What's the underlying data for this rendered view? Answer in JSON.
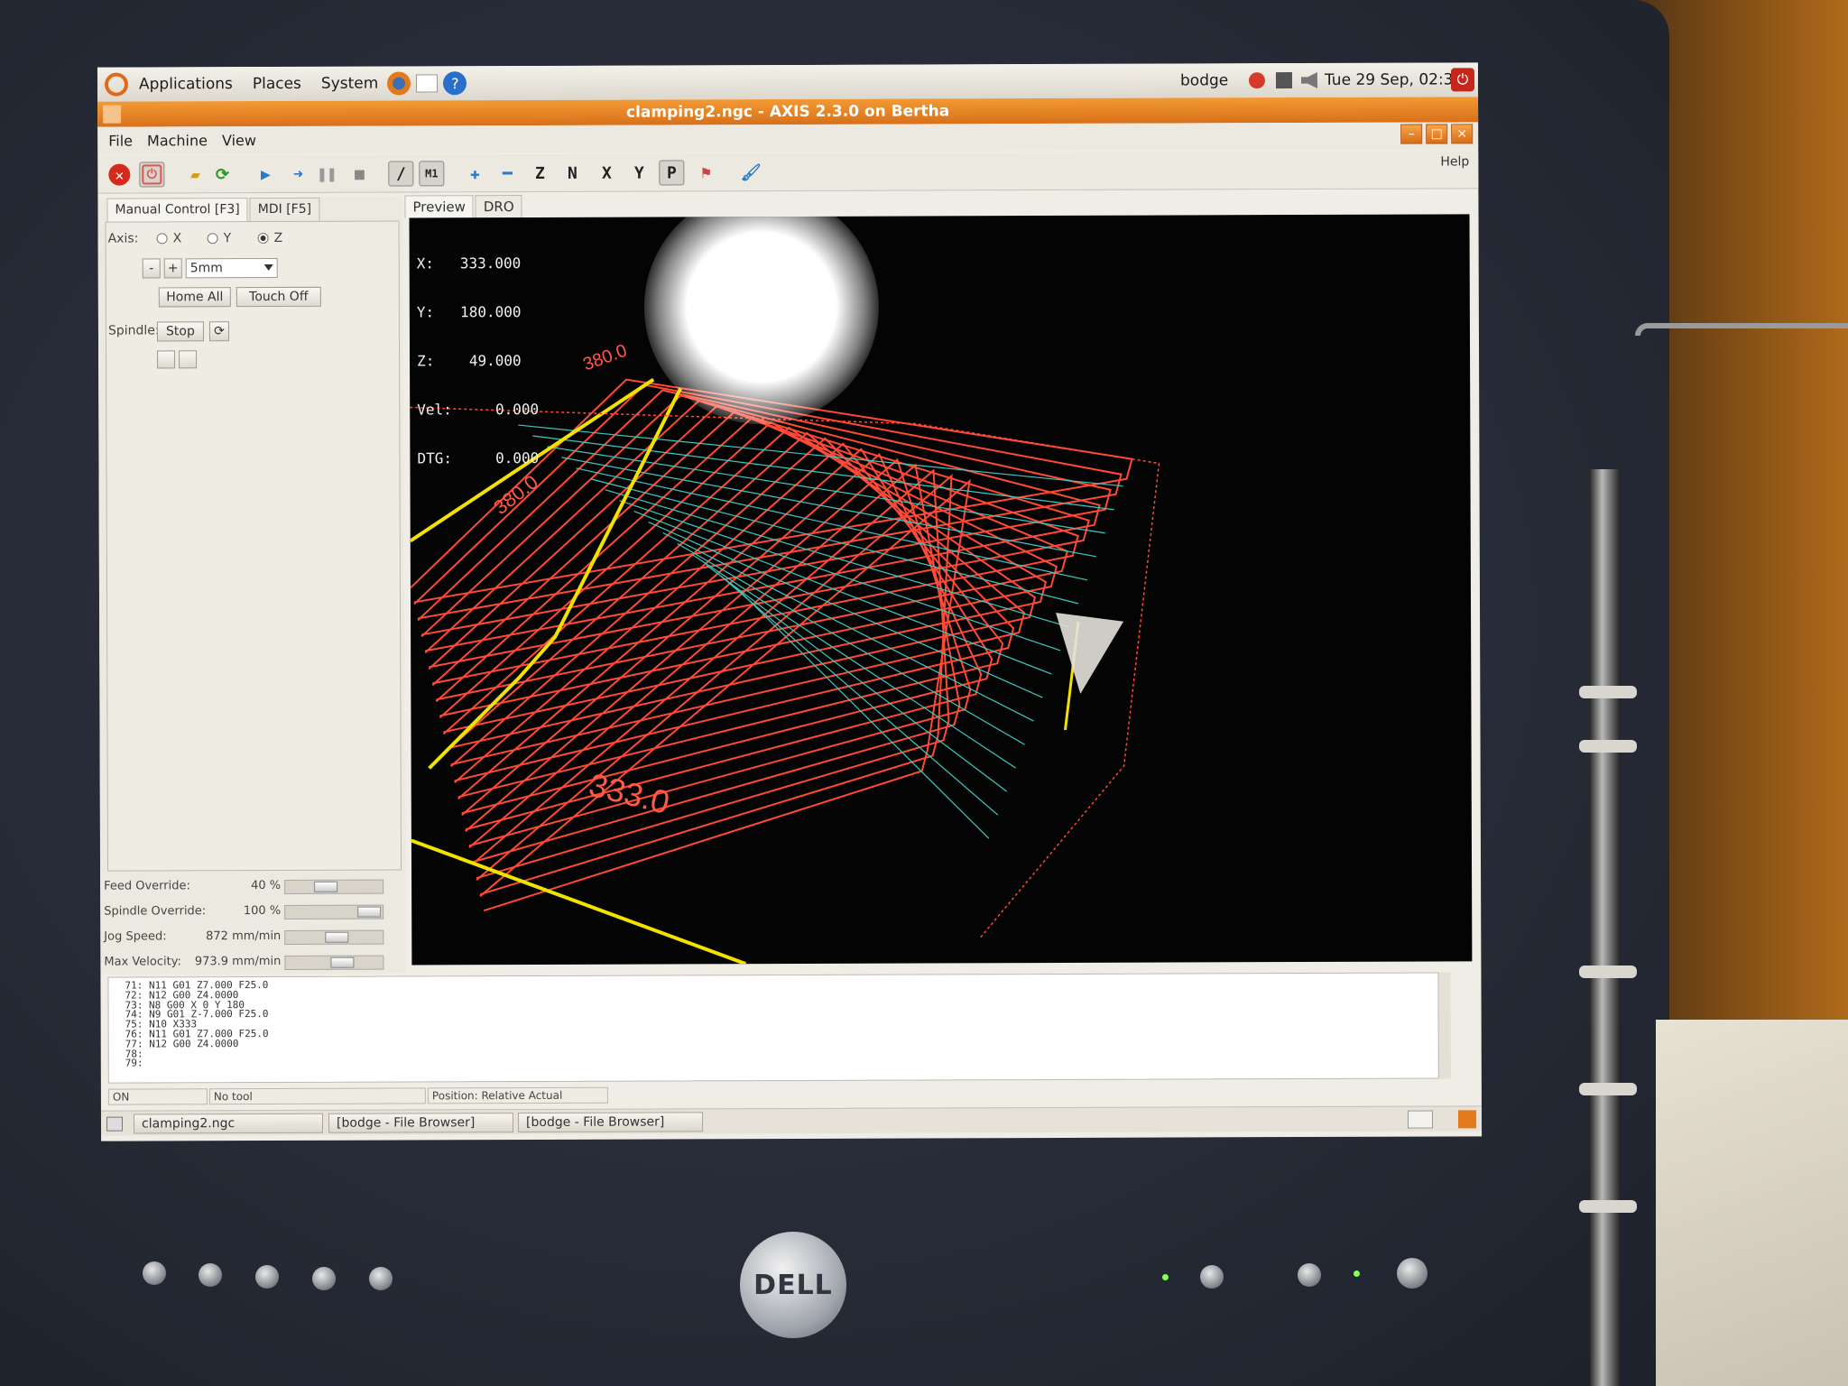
{
  "panel": {
    "menus": [
      "Applications",
      "Places",
      "System"
    ],
    "user": "bodge",
    "clock": "Tue 29 Sep, 02:33"
  },
  "window": {
    "title": "clamping2.ngc - AXIS 2.3.0 on Bertha",
    "menus": [
      "File",
      "Machine",
      "View"
    ],
    "help": "Help"
  },
  "left_tabs": [
    "Manual Control [F3]",
    "MDI [F5]"
  ],
  "manual": {
    "axis_label": "Axis:",
    "axes": [
      "X",
      "Y",
      "Z"
    ],
    "selected_axis": "Z",
    "minus": "-",
    "plus": "+",
    "increment": "5mm",
    "home_button": "Home All",
    "touch_off_button": "Touch Off",
    "spindle_label": "Spindle:",
    "stop_button": "Stop"
  },
  "overrides": [
    {
      "name": "Feed Override:",
      "value": "40 %",
      "level": 0.4
    },
    {
      "name": "Spindle Override:",
      "value": "100 %",
      "level": 1.0
    },
    {
      "name": "Jog Speed:",
      "value": "872 mm/min",
      "level": 0.55
    },
    {
      "name": "Max Velocity:",
      "value": "973.9 mm/min",
      "level": 0.62
    }
  ],
  "preview_tabs": [
    "Preview",
    "DRO"
  ],
  "dro": {
    "x": "X:   333.000",
    "y": "Y:   180.000",
    "z": "Z:    49.000",
    "vel": "Vel:     0.000",
    "dtg": "DTG:     0.000"
  },
  "dimensions": {
    "a": "380.0",
    "b": "380.0",
    "c": "333.0"
  },
  "gcode": [
    "71: N11 G01 Z7.000 F25.0",
    "72: N12 G00 Z4.0000",
    "73: N8 G00 X 0 Y 180",
    "74: N9 G01 Z-7.000 F25.0",
    "75: N10 X333",
    "76: N11 G01 Z7.000 F25.0",
    "77: N12 G00 Z4.0000",
    "78:",
    "79:"
  ],
  "status": {
    "state": "ON",
    "tool": "No tool",
    "position": "Position: Relative Actual"
  },
  "taskbar": [
    "clamping2.ngc",
    "[bodge - File Browser]",
    "[bodge - File Browser]"
  ],
  "monitor_brand": "DELL",
  "colors": {
    "title": "#e07a1c",
    "path_red": "#ff4a36",
    "path_cyan": "#3ec8c0",
    "limit_yellow": "#f2e200"
  }
}
